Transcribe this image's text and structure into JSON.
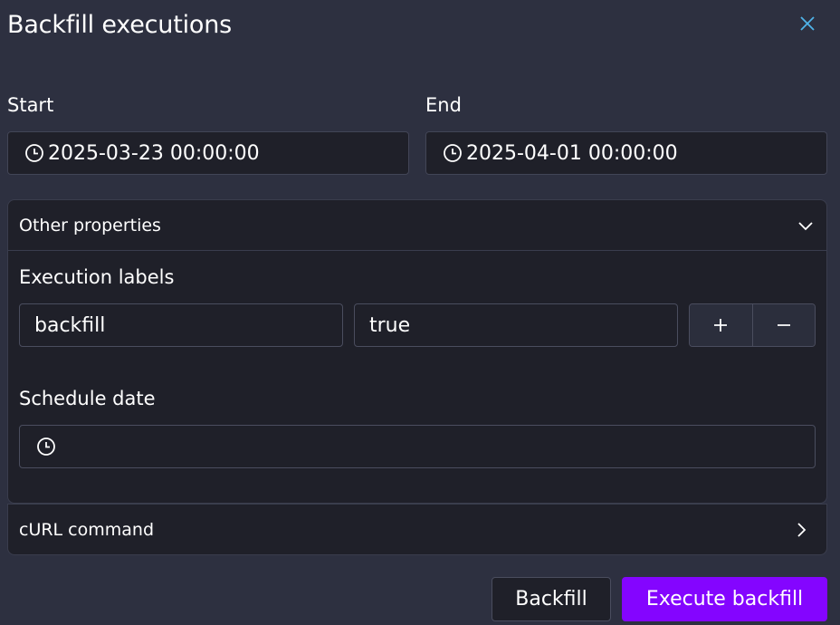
{
  "dialog": {
    "title": "Backfill executions",
    "close_icon": "close-icon"
  },
  "start": {
    "label": "Start",
    "value": "2025-03-23 00:00:00",
    "icon": "clock-icon"
  },
  "end": {
    "label": "End",
    "value": "2025-04-01 00:00:00",
    "icon": "clock-icon"
  },
  "other_properties": {
    "header": "Other properties",
    "expanded": true,
    "execution_labels": {
      "label": "Execution labels",
      "key": "backfill",
      "value": "true",
      "add_icon": "plus-icon",
      "remove_icon": "minus-icon"
    },
    "schedule_date": {
      "label": "Schedule date",
      "value": "",
      "icon": "clock-icon"
    }
  },
  "curl": {
    "header": "cURL command",
    "expanded": false
  },
  "actions": {
    "backfill_label": "Backfill",
    "execute_label": "Execute backfill"
  },
  "colors": {
    "background": "#2d3040",
    "panel": "#1f2029",
    "accent": "#8405ff",
    "close_icon": "#4fb3e8"
  }
}
